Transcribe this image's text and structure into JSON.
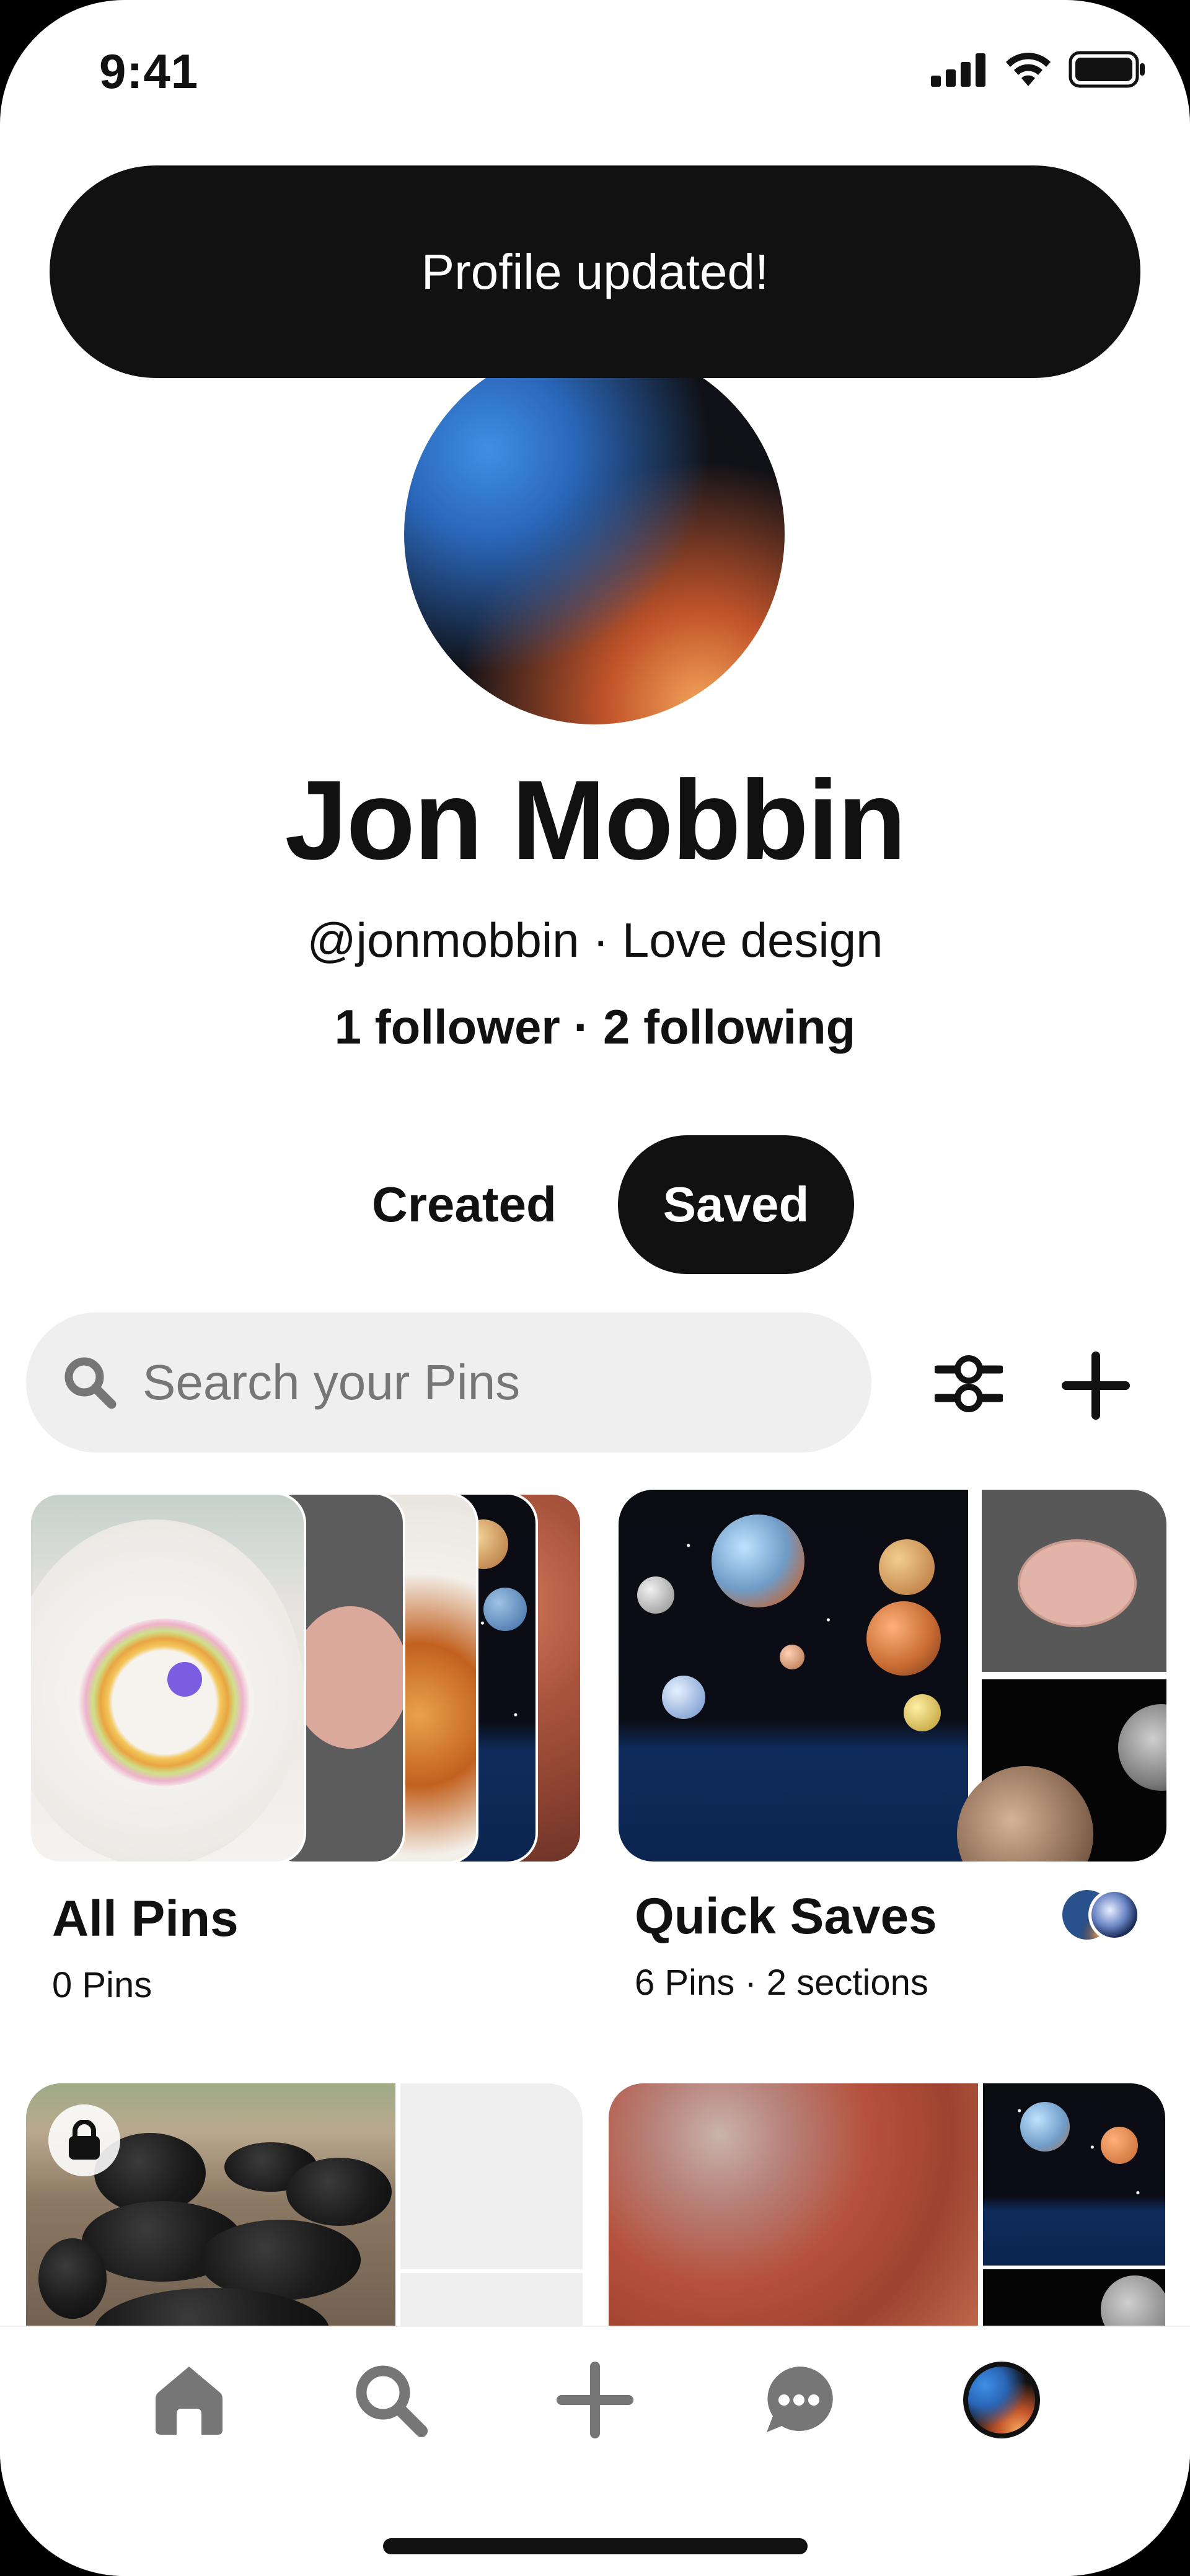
{
  "status_bar": {
    "time": "9:41"
  },
  "toast": {
    "message": "Profile updated!"
  },
  "profile": {
    "name": "Jon Mobbin",
    "handle_line": "@jonmobbin · Love design",
    "follow_line": "1 follower · 2 following"
  },
  "tabs": {
    "created": "Created",
    "saved": "Saved",
    "selected": "Saved"
  },
  "search": {
    "placeholder": "Search your Pins"
  },
  "boards": [
    {
      "title": "All Pins",
      "meta": "0 Pins"
    },
    {
      "title": "Quick Saves",
      "meta": "6 Pins · 2 sections"
    }
  ],
  "icons": {
    "status": [
      "signal-icon",
      "wifi-icon",
      "battery-icon"
    ],
    "search": "search-icon",
    "filter": "filter-sliders-icon",
    "add": "plus-icon",
    "nav": [
      "home-icon",
      "search-icon",
      "plus-icon",
      "chat-icon",
      "profile-avatar"
    ]
  },
  "colors": {
    "primary_text": "#111111",
    "toast_bg": "#111111",
    "search_bg": "#efefef",
    "placeholder": "#767676",
    "nav_inactive": "#767676"
  }
}
